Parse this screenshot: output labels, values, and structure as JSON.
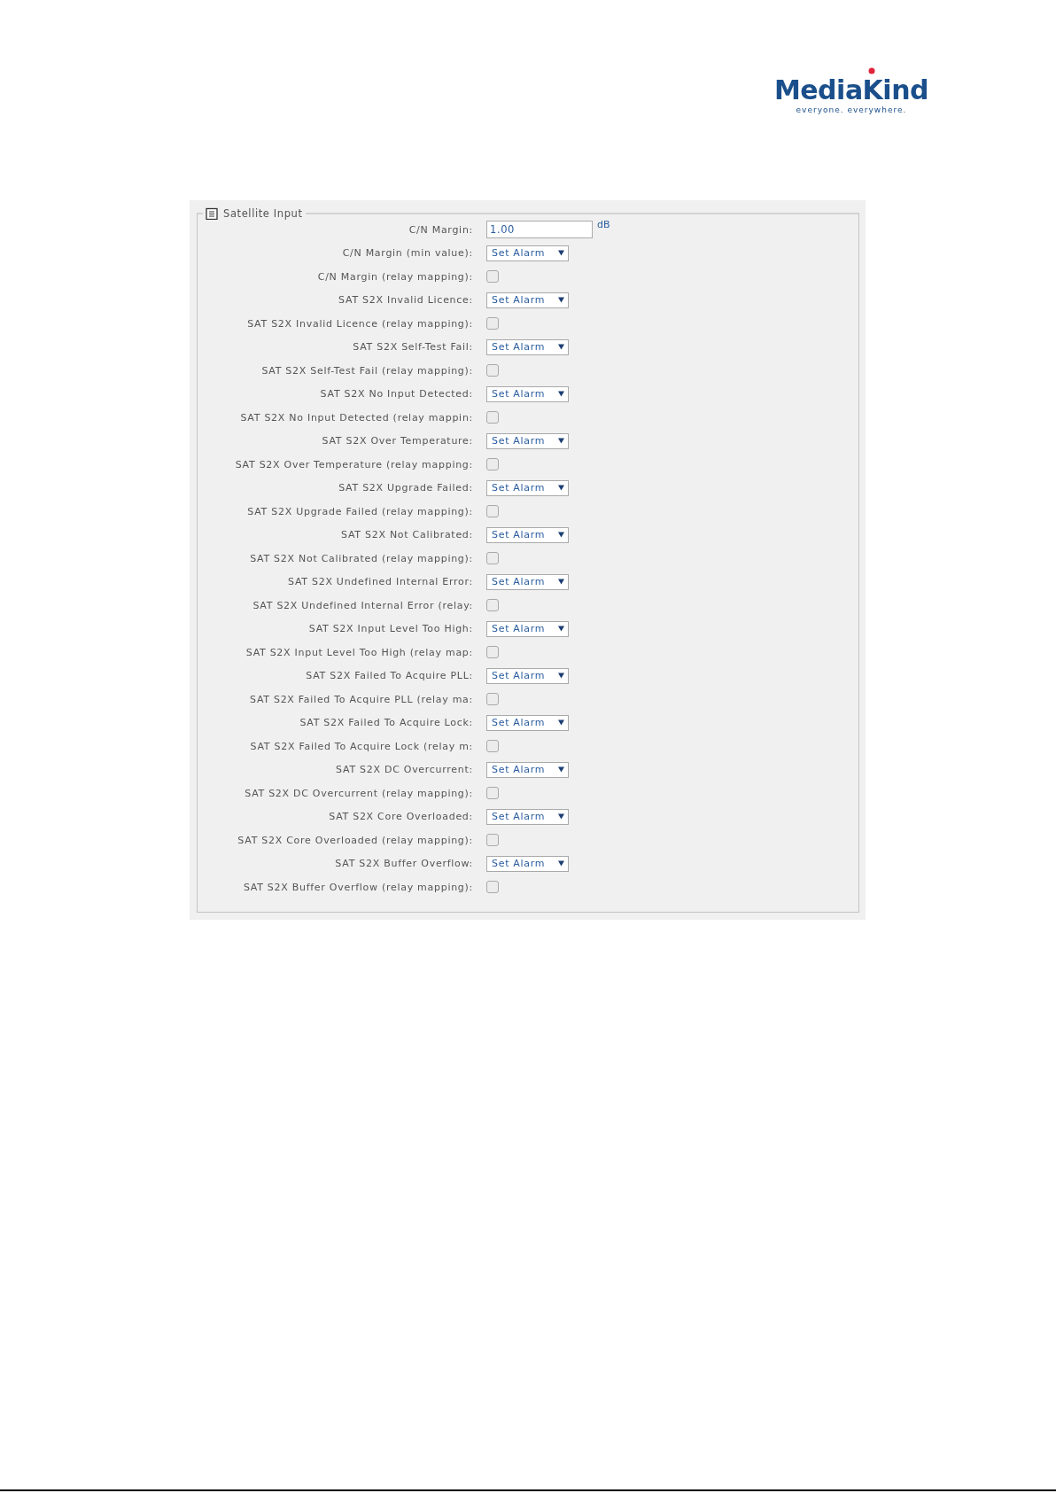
{
  "logo": {
    "name": "MediaKind",
    "tagline": "everyone. everywhere."
  },
  "panel": {
    "title": "Satellite Input",
    "rows": [
      {
        "kind": "text",
        "label": "C/N Margin:",
        "value": "1.00",
        "unit": "dB"
      },
      {
        "kind": "select",
        "label": "C/N Margin (min value):",
        "value": "Set Alarm"
      },
      {
        "kind": "checkbox",
        "label": "C/N Margin (relay mapping):",
        "checked": false
      },
      {
        "kind": "select",
        "label": "SAT S2X Invalid Licence:",
        "value": "Set Alarm"
      },
      {
        "kind": "checkbox",
        "label": "SAT S2X Invalid Licence (relay mapping):",
        "checked": false
      },
      {
        "kind": "select",
        "label": "SAT S2X Self-Test Fail:",
        "value": "Set Alarm"
      },
      {
        "kind": "checkbox",
        "label": "SAT S2X Self-Test Fail (relay mapping):",
        "checked": false
      },
      {
        "kind": "select",
        "label": "SAT S2X No Input Detected:",
        "value": "Set Alarm"
      },
      {
        "kind": "checkbox",
        "label": "SAT S2X No Input Detected (relay mappin:",
        "checked": false
      },
      {
        "kind": "select",
        "label": "SAT S2X Over Temperature:",
        "value": "Set Alarm"
      },
      {
        "kind": "checkbox",
        "label": "SAT S2X Over Temperature (relay mapping:",
        "checked": false
      },
      {
        "kind": "select",
        "label": "SAT S2X Upgrade Failed:",
        "value": "Set Alarm"
      },
      {
        "kind": "checkbox",
        "label": "SAT S2X Upgrade Failed (relay mapping):",
        "checked": false
      },
      {
        "kind": "select",
        "label": "SAT S2X Not Calibrated:",
        "value": "Set Alarm"
      },
      {
        "kind": "checkbox",
        "label": "SAT S2X Not Calibrated (relay mapping):",
        "checked": false
      },
      {
        "kind": "select",
        "label": "SAT S2X Undefined Internal Error:",
        "value": "Set Alarm"
      },
      {
        "kind": "checkbox",
        "label": "SAT S2X Undefined Internal Error (relay:",
        "checked": false
      },
      {
        "kind": "select",
        "label": "SAT S2X Input Level Too High:",
        "value": "Set Alarm"
      },
      {
        "kind": "checkbox",
        "label": "SAT S2X Input Level Too High (relay map:",
        "checked": false
      },
      {
        "kind": "select",
        "label": "SAT S2X Failed To Acquire PLL:",
        "value": "Set Alarm"
      },
      {
        "kind": "checkbox",
        "label": "SAT S2X Failed To Acquire PLL (relay ma:",
        "checked": false
      },
      {
        "kind": "select",
        "label": "SAT S2X Failed To Acquire Lock:",
        "value": "Set Alarm"
      },
      {
        "kind": "checkbox",
        "label": "SAT S2X Failed To Acquire Lock (relay m:",
        "checked": false
      },
      {
        "kind": "select",
        "label": "SAT S2X DC Overcurrent:",
        "value": "Set Alarm"
      },
      {
        "kind": "checkbox",
        "label": "SAT S2X DC Overcurrent (relay mapping):",
        "checked": false
      },
      {
        "kind": "select",
        "label": "SAT S2X Core Overloaded:",
        "value": "Set Alarm"
      },
      {
        "kind": "checkbox",
        "label": "SAT S2X Core Overloaded (relay mapping):",
        "checked": false
      },
      {
        "kind": "select",
        "label": "SAT S2X Buffer Overflow:",
        "value": "Set Alarm"
      },
      {
        "kind": "checkbox",
        "label": "SAT S2X Buffer Overflow (relay mapping):",
        "checked": false
      }
    ]
  }
}
